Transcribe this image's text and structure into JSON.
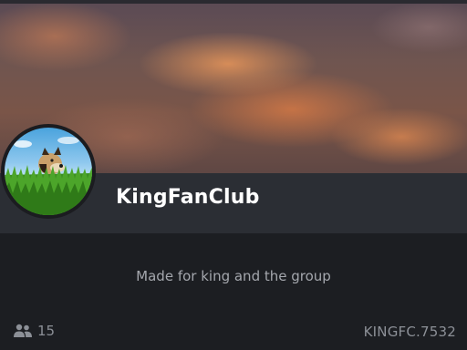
{
  "group": {
    "name": "KingFanClub",
    "description": "Made for king and the group",
    "member_count": "15",
    "code": "KINGFC.7532"
  },
  "icons": {
    "avatar": "dog-in-grass-avatar",
    "members": "members-icon"
  },
  "colors": {
    "background": "#1c1e22",
    "name_bar": "#2b2e34",
    "name_text": "#ffffff",
    "muted_text": "#8c9097"
  }
}
